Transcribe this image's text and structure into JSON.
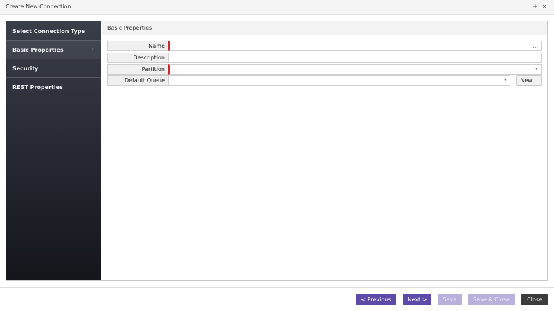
{
  "window": {
    "title": "Create New Connection",
    "pin_glyph": "+",
    "close_glyph": "×"
  },
  "sidebar": {
    "items": [
      {
        "label": "Select Connection Type"
      },
      {
        "label": "Basic Properties",
        "chevron": "›"
      },
      {
        "label": "Security"
      },
      {
        "label": "REST Properties"
      }
    ]
  },
  "main": {
    "section_title": "Basic Properties",
    "fields": {
      "name": {
        "label": "Name",
        "value": "",
        "ellipsis": "..."
      },
      "description": {
        "label": "Description",
        "value": "",
        "ellipsis": "..."
      },
      "partition": {
        "label": "Partition",
        "value": "",
        "caret": "▾"
      },
      "default_queue": {
        "label": "Default Queue",
        "value": "",
        "caret": "▾",
        "new_label": "New..."
      }
    }
  },
  "footer": {
    "previous": "< Previous",
    "next": "Next >",
    "save": "Save",
    "save_close": "Save & Close",
    "close": "Close"
  },
  "colors": {
    "accent": "#5e4aa8",
    "disabled_accent": "#b9b0dc",
    "required_marker": "#c8282e",
    "sidebar_bg": "#2a2d36"
  }
}
